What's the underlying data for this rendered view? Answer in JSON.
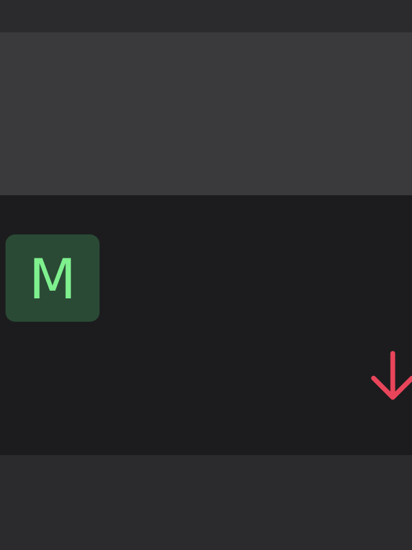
{
  "top_bar": {},
  "header_band": {},
  "list_row": {
    "avatar": {
      "initial": "M",
      "tile_color": "#2a4a35",
      "letter_color": "#7ef08e"
    },
    "trend_icon": {
      "name": "arrow-down-icon",
      "color": "#e8455a"
    }
  },
  "colors": {
    "background": "#1c1c1e",
    "top_bar": "#2b2b2e",
    "header_band": "#3a3a3c",
    "bottom_band": "#2b2b2e"
  }
}
